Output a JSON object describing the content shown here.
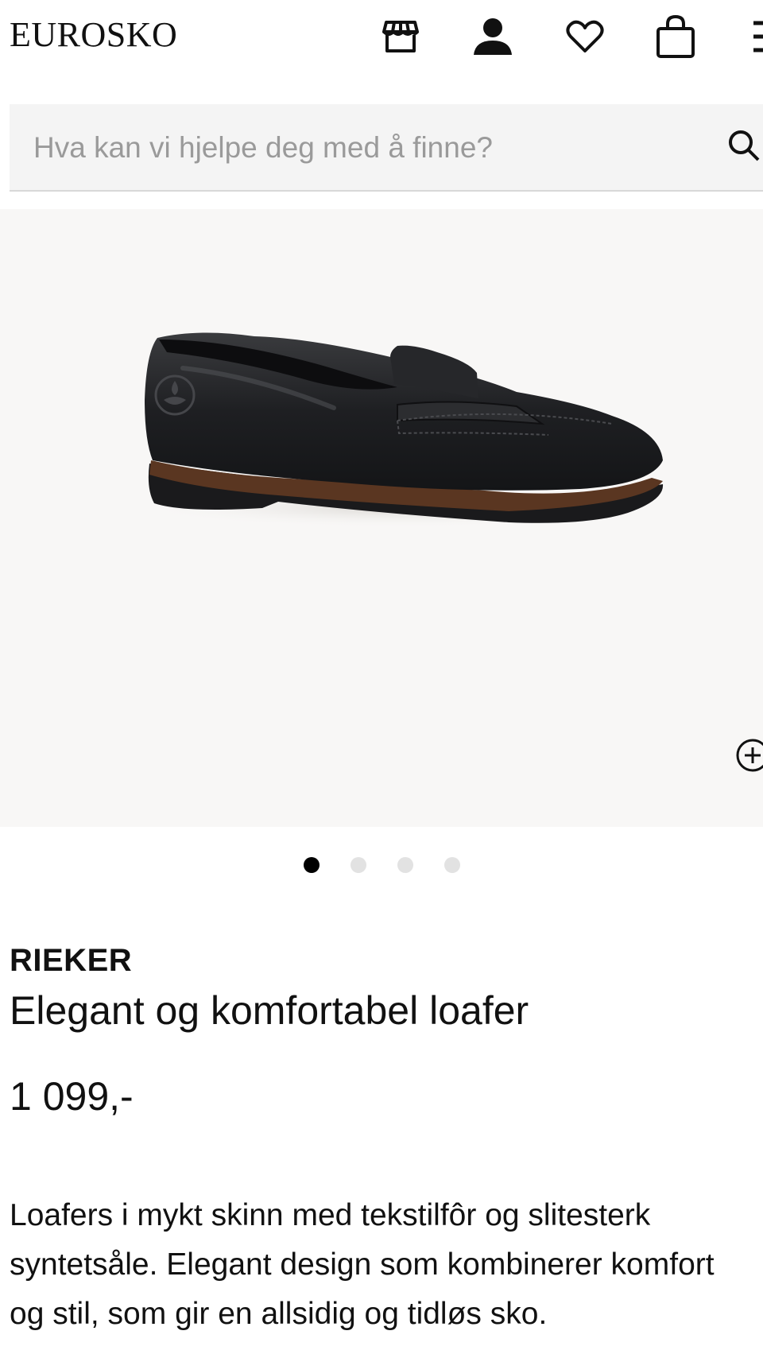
{
  "header": {
    "logo": "EUROSKO",
    "icons": [
      "store-icon",
      "account-icon",
      "heart-icon",
      "bag-icon",
      "menu-icon"
    ]
  },
  "search": {
    "placeholder": "Hva kan vi hjelpe deg med å finne?",
    "value": ""
  },
  "gallery": {
    "image_count": 4,
    "active_index": 0,
    "background": "#f8f7f6"
  },
  "product": {
    "brand": "RIEKER",
    "name": "Elegant og komfortabel loafer",
    "price": "1 099,-",
    "description": "Loafers i mykt skinn med tekstilfôr og slitesterk syntetsåle. Elegant design som kombinerer komfort og stil, som gir en allsidig og tidløs sko."
  },
  "colors": {
    "text": "#111111",
    "search_bg": "#f4f4f4",
    "dot_inactive": "#e2e2e2",
    "dot_active": "#000000"
  }
}
